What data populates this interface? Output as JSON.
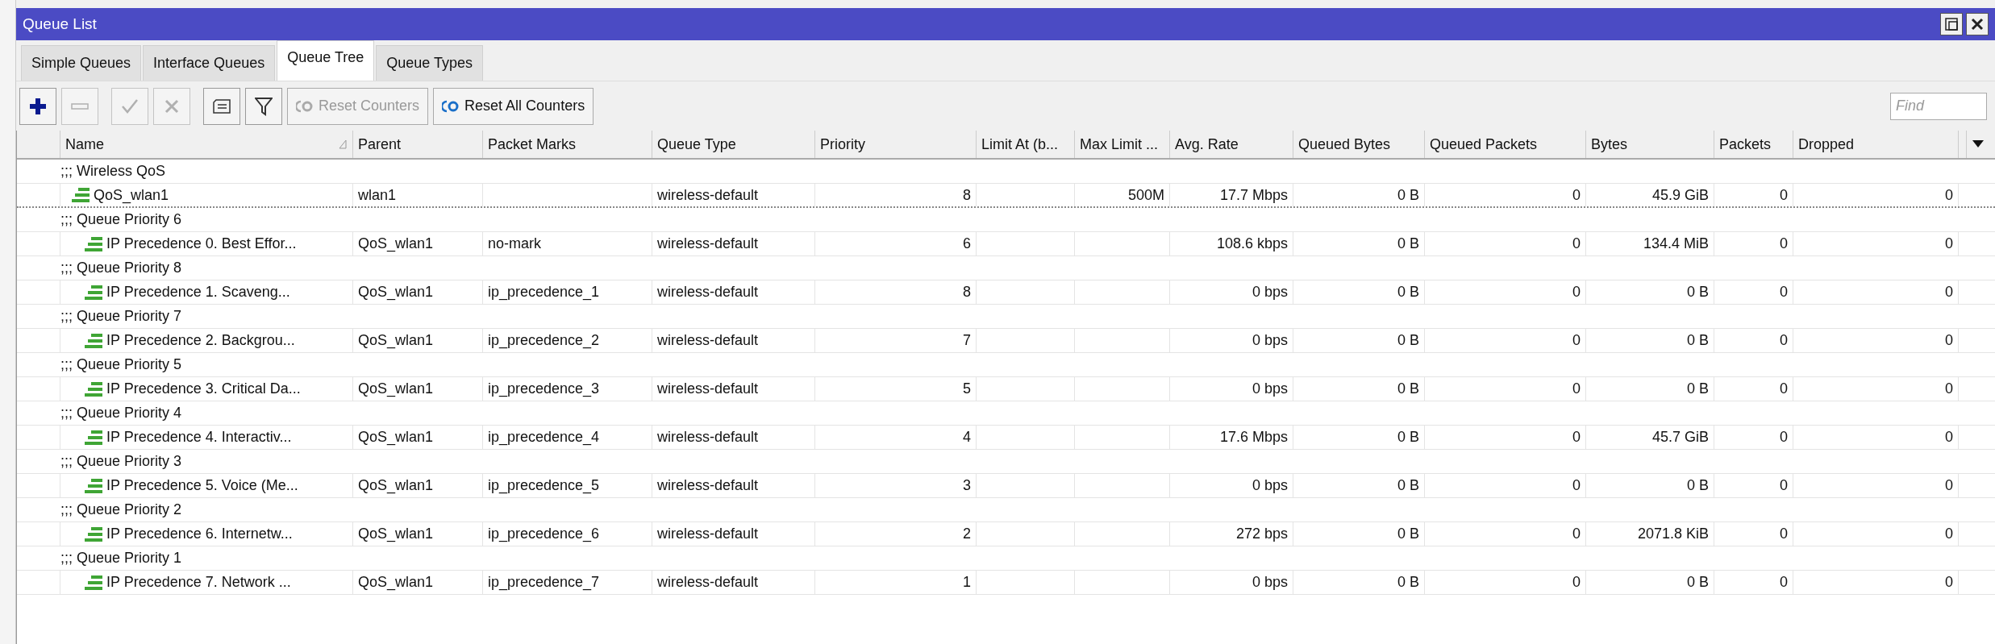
{
  "window": {
    "title": "Queue List"
  },
  "tabs": [
    {
      "label": "Simple Queues",
      "selected": false
    },
    {
      "label": "Interface Queues",
      "selected": false
    },
    {
      "label": "Queue Tree",
      "selected": true
    },
    {
      "label": "Queue Types",
      "selected": false
    }
  ],
  "toolbar": [
    {
      "kind": "add",
      "disabled": false
    },
    {
      "kind": "remove",
      "disabled": true
    },
    {
      "kind": "enable",
      "disabled": true
    },
    {
      "kind": "disable",
      "disabled": true
    },
    {
      "kind": "comment",
      "disabled": false
    },
    {
      "kind": "filter",
      "disabled": false
    },
    {
      "kind": "reset",
      "label": "Reset Counters",
      "disabled": true
    },
    {
      "kind": "reset",
      "label": "Reset All Counters",
      "disabled": false
    }
  ],
  "find": {
    "placeholder": "Find"
  },
  "columns": [
    {
      "label": "Name",
      "sorted": true
    },
    {
      "label": "Parent",
      "sorted": false
    },
    {
      "label": "Packet Marks",
      "sorted": false
    },
    {
      "label": "Queue Type",
      "sorted": false
    },
    {
      "label": "Priority",
      "sorted": false
    },
    {
      "label": "Limit At (b...",
      "sorted": false
    },
    {
      "label": "Max Limit ...",
      "sorted": false
    },
    {
      "label": "Avg. Rate",
      "sorted": false
    },
    {
      "label": "Queued Bytes",
      "sorted": false
    },
    {
      "label": "Queued Packets",
      "sorted": false
    },
    {
      "label": "Bytes",
      "sorted": false
    },
    {
      "label": "Packets",
      "sorted": false
    },
    {
      "label": "Dropped",
      "sorted": false
    }
  ],
  "queues": [
    {
      "comment": ";;; Wireless QoS",
      "selected": true,
      "cells": [
        "QoS_wlan1",
        "wlan1",
        "",
        "wireless-default",
        "8",
        "",
        "500M",
        "17.7 Mbps",
        "0 B",
        "0",
        "45.9 GiB",
        "0",
        "0"
      ],
      "children": [
        {
          "comment": ";;; Queue Priority 6",
          "selected": false,
          "cells": [
            "IP Precedence 0. Best Effor...",
            "QoS_wlan1",
            "no-mark",
            "wireless-default",
            "6",
            "",
            "",
            "108.6 kbps",
            "0 B",
            "0",
            "134.4 MiB",
            "0",
            "0"
          ]
        },
        {
          "comment": ";;; Queue Priority 8",
          "selected": false,
          "cells": [
            "IP Precedence 1. Scaveng...",
            "QoS_wlan1",
            "ip_precedence_1",
            "wireless-default",
            "8",
            "",
            "",
            "0 bps",
            "0 B",
            "0",
            "0 B",
            "0",
            "0"
          ]
        },
        {
          "comment": ";;; Queue Priority 7",
          "selected": false,
          "cells": [
            "IP Precedence 2. Backgrou...",
            "QoS_wlan1",
            "ip_precedence_2",
            "wireless-default",
            "7",
            "",
            "",
            "0 bps",
            "0 B",
            "0",
            "0 B",
            "0",
            "0"
          ]
        },
        {
          "comment": ";;; Queue Priority 5",
          "selected": false,
          "cells": [
            "IP Precedence 3. Critical Da...",
            "QoS_wlan1",
            "ip_precedence_3",
            "wireless-default",
            "5",
            "",
            "",
            "0 bps",
            "0 B",
            "0",
            "0 B",
            "0",
            "0"
          ]
        },
        {
          "comment": ";;; Queue Priority 4",
          "selected": false,
          "cells": [
            "IP Precedence 4. Interactiv...",
            "QoS_wlan1",
            "ip_precedence_4",
            "wireless-default",
            "4",
            "",
            "",
            "17.6 Mbps",
            "0 B",
            "0",
            "45.7 GiB",
            "0",
            "0"
          ]
        },
        {
          "comment": ";;; Queue Priority 3",
          "selected": false,
          "cells": [
            "IP Precedence 5. Voice (Me...",
            "QoS_wlan1",
            "ip_precedence_5",
            "wireless-default",
            "3",
            "",
            "",
            "0 bps",
            "0 B",
            "0",
            "0 B",
            "0",
            "0"
          ]
        },
        {
          "comment": ";;; Queue Priority 2",
          "selected": false,
          "cells": [
            "IP Precedence 6. Internetw...",
            "QoS_wlan1",
            "ip_precedence_6",
            "wireless-default",
            "2",
            "",
            "",
            "272 bps",
            "0 B",
            "0",
            "2071.8 KiB",
            "0",
            "0"
          ]
        },
        {
          "comment": ";;; Queue Priority 1",
          "selected": false,
          "cells": [
            "IP Precedence 7. Network ...",
            "QoS_wlan1",
            "ip_precedence_7",
            "wireless-default",
            "1",
            "",
            "",
            "0 bps",
            "0 B",
            "0",
            "0 B",
            "0",
            "0"
          ]
        }
      ]
    }
  ]
}
